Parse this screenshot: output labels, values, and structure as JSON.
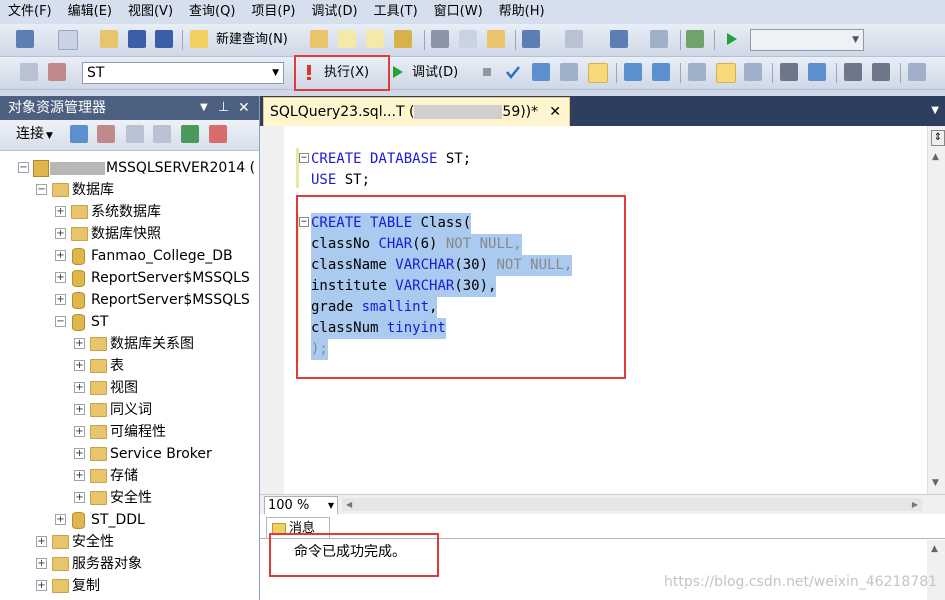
{
  "menu": [
    "文件(F)",
    "编辑(E)",
    "视图(V)",
    "查询(Q)",
    "项目(P)",
    "调试(D)",
    "工具(T)",
    "窗口(W)",
    "帮助(H)"
  ],
  "toolbar": {
    "new_query_label": "新建查询(N)",
    "database_select": "ST",
    "execute_label": "执行(X)",
    "debug_label": "调试(D)"
  },
  "object_explorer": {
    "title": "对象资源管理器",
    "connect_label": "连接",
    "tree": [
      {
        "label": "MSSQLSERVER2014 (",
        "expander": "−",
        "icon": "server"
      },
      {
        "label": "数据库",
        "expander": "−",
        "icon": "folder"
      },
      {
        "label": "系统数据库",
        "expander": "+",
        "icon": "folder"
      },
      {
        "label": "数据库快照",
        "expander": "+",
        "icon": "folder"
      },
      {
        "label": "Fanmao_College_DB",
        "expander": "+",
        "icon": "db"
      },
      {
        "label": "ReportServer$MSSQLS",
        "expander": "+",
        "icon": "db"
      },
      {
        "label": "ReportServer$MSSQLS",
        "expander": "+",
        "icon": "db"
      },
      {
        "label": "ST",
        "expander": "−",
        "icon": "db"
      },
      {
        "label": "数据库关系图",
        "expander": "+",
        "icon": "folder"
      },
      {
        "label": "表",
        "expander": "+",
        "icon": "folder"
      },
      {
        "label": "视图",
        "expander": "+",
        "icon": "folder"
      },
      {
        "label": "同义词",
        "expander": "+",
        "icon": "folder"
      },
      {
        "label": "可编程性",
        "expander": "+",
        "icon": "folder"
      },
      {
        "label": "Service Broker",
        "expander": "+",
        "icon": "folder"
      },
      {
        "label": "存储",
        "expander": "+",
        "icon": "folder"
      },
      {
        "label": "安全性",
        "expander": "+",
        "icon": "folder"
      },
      {
        "label": "ST_DDL",
        "expander": "+",
        "icon": "db"
      },
      {
        "label": "安全性",
        "expander": "+",
        "icon": "folder"
      },
      {
        "label": "服务器对象",
        "expander": "+",
        "icon": "folder"
      },
      {
        "label": "复制",
        "expander": "+",
        "icon": "folder"
      }
    ]
  },
  "editor": {
    "tab_label_prefix": "SQLQuery23.sql...T (",
    "tab_label_suffix": "59))*",
    "lines": {
      "l1_kw": "CREATE DATABASE",
      "l1_rest": " ST;",
      "l2_kw": "USE",
      "l2_rest": " ST;",
      "l3_kw": "CREATE TABLE",
      "l3_rest": " Class(",
      "l4_a": "classNo ",
      "l4_kw": "CHAR",
      "l4_b": "(6) ",
      "l4_g": "NOT NULL,",
      "l5_a": "className ",
      "l5_kw": "VARCHAR",
      "l5_b": "(30) ",
      "l5_g": "NOT NULL,",
      "l6_a": "institute ",
      "l6_kw": "VARCHAR",
      "l6_b": "(30),",
      "l7_a": "grade ",
      "l7_kw": "smallint",
      "l7_b": ",",
      "l8_a": "classNum ",
      "l8_kw": "tinyint",
      "l9": ");"
    },
    "zoom": "100 %"
  },
  "results": {
    "tab_label": "消息",
    "message": "命令已成功完成。"
  },
  "watermark": "https://blog.csdn.net/weixin_46218781",
  "colors": {
    "accent_red": "#e03a3a",
    "selection": "#aacbef",
    "keyword": "#1a1ad6"
  }
}
